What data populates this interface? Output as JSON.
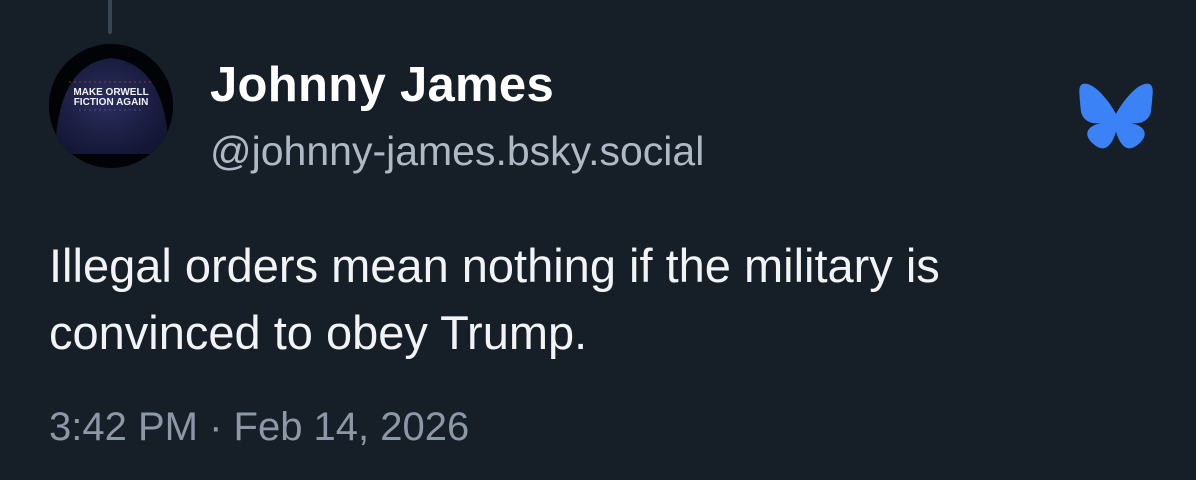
{
  "post": {
    "author": {
      "display_name": "Johnny James",
      "handle": "@johnny-james.bsky.social",
      "avatar": {
        "icon": "cap-avatar-image",
        "cap_text_line1": "MAKE ORWELL",
        "cap_text_line2": "FICTION AGAIN"
      }
    },
    "text_lines": [
      "Illegal orders mean nothing if the military is",
      "convinced to obey Trump."
    ],
    "timestamp": "3:42 PM · Feb 14, 2026"
  },
  "brand": {
    "icon": "bluesky-butterfly-icon",
    "color": "#3b82f6"
  },
  "colors": {
    "background": "#161e27",
    "handle": "#aeb9c6",
    "timestamp": "#8c98a7"
  }
}
